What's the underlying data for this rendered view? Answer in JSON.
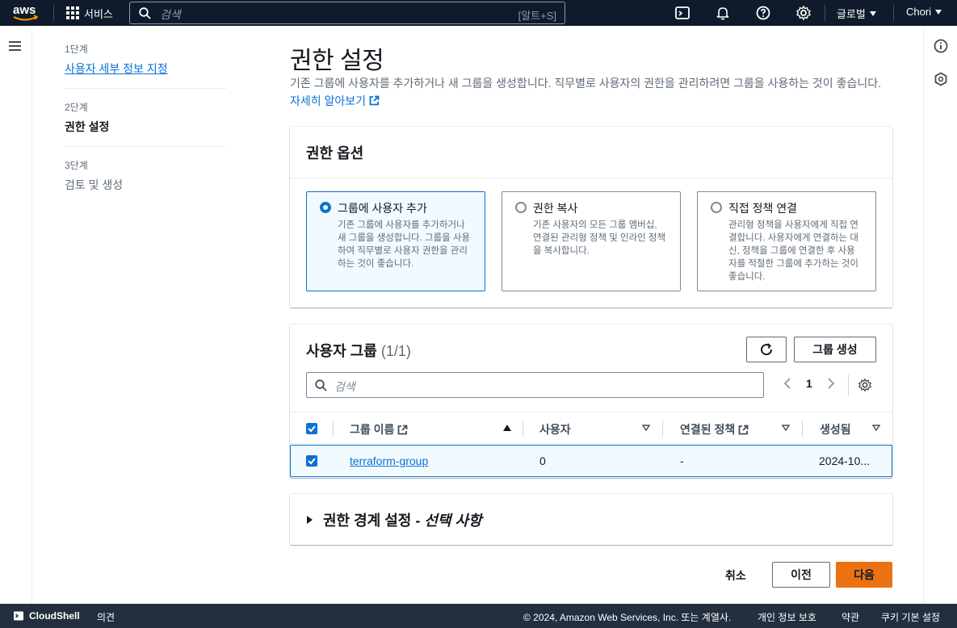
{
  "topnav": {
    "logo_text": "aws",
    "services_label": "서비스",
    "search_placeholder": "검색",
    "search_shortcut": "[알트+S]",
    "region_label": "글로벌",
    "user_label": "Chori"
  },
  "wizard_steps": [
    {
      "num": "1단계",
      "label": "사용자 세부 정보 지정",
      "state": "link"
    },
    {
      "num": "2단계",
      "label": "권한 설정",
      "state": "current"
    },
    {
      "num": "3단계",
      "label": "검토 및 생성",
      "state": "disabled"
    }
  ],
  "page": {
    "title": "권한 설정",
    "description": "기존 그룹에 사용자를 추가하거나 새 그룹을 생성합니다. 직무별로 사용자의 권한을 관리하려면 그룹을 사용하는 것이 좋습니다.",
    "learn_more": "자세히 알아보기"
  },
  "permission_options": {
    "heading": "권한 옵션",
    "options": [
      {
        "title": "그룹에 사용자 추가",
        "desc": "기존 그룹에 사용자를 추가하거나 새 그룹을 생성합니다. 그룹을 사용하여 직무별로 사용자 권한을 관리하는 것이 좋습니다.",
        "selected": true
      },
      {
        "title": "권한 복사",
        "desc": "기존 사용자의 모든 그룹 멤버십, 연결된 관리형 정책 및 인라인 정책을 복사합니다.",
        "selected": false
      },
      {
        "title": "직접 정책 연결",
        "desc": "관리형 정책을 사용자에게 직접 연결합니다. 사용자에게 연결하는 대신, 정책을 그룹에 연결한 후 사용자를 적절한 그룹에 추가하는 것이 좋습니다.",
        "selected": false
      }
    ]
  },
  "user_groups": {
    "heading": "사용자 그룹",
    "count": "(1/1)",
    "create_button": "그룹 생성",
    "search_placeholder": "검색",
    "page_number": "1",
    "columns": [
      "그룹 이름",
      "사용자",
      "연결된 정책",
      "생성됨"
    ],
    "rows": [
      {
        "name": "terraform-group",
        "users": "0",
        "policies": "-",
        "created": "2024-10...",
        "checked": true
      }
    ]
  },
  "boundary": {
    "title": "권한 경계 설정 - ",
    "optional": "선택 사항"
  },
  "actions": {
    "cancel": "취소",
    "previous": "이전",
    "next": "다음"
  },
  "footer": {
    "cloudshell": "CloudShell",
    "feedback": "의견",
    "copyright": "© 2024, Amazon Web Services, Inc. 또는 계열사.",
    "privacy": "개인 정보 보호",
    "terms": "약관",
    "cookies": "쿠키 기본 설정"
  },
  "colors": {
    "nav_bg": "#0f1b2a",
    "footer_bg": "#232f3e",
    "accent": "#0972d3",
    "primary_button": "#ec7211"
  }
}
